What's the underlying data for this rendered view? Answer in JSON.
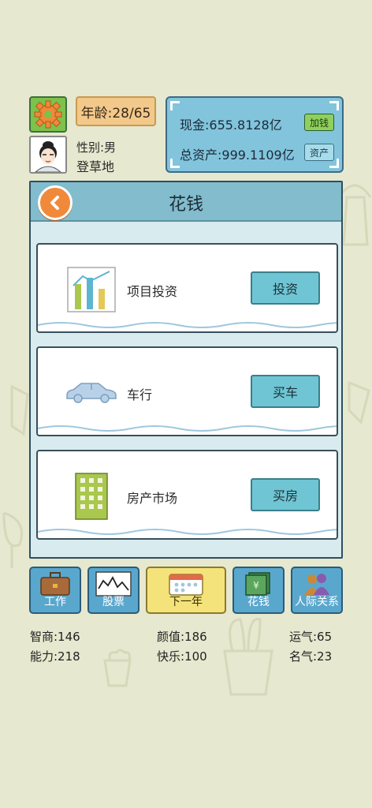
{
  "status": {
    "age_label": "年龄:28/65",
    "gender_label": "性别:男",
    "title": "登草地"
  },
  "money": {
    "cash_label": "现金:655.8128亿",
    "cash_button": "加钱",
    "assets_label": "总资产:999.1109亿",
    "assets_button": "资产"
  },
  "panel": {
    "title": "花钱",
    "cards": [
      {
        "label": "项目投资",
        "button": "投资",
        "icon": "chart-icon"
      },
      {
        "label": "车行",
        "button": "买车",
        "icon": "car-icon"
      },
      {
        "label": "房产市场",
        "button": "买房",
        "icon": "building-icon"
      }
    ]
  },
  "nav": {
    "items": [
      {
        "label": "工作",
        "icon": "briefcase-icon"
      },
      {
        "label": "股票",
        "icon": "stock-chart-icon"
      },
      {
        "label": "下一年",
        "icon": "calendar-icon"
      },
      {
        "label": "花钱",
        "icon": "money-icon"
      },
      {
        "label": "人际关系",
        "icon": "people-icon"
      }
    ]
  },
  "stats": {
    "iq": "智商:146",
    "ability": "能力:218",
    "looks": "颜值:186",
    "happiness": "快乐:100",
    "luck": "运气:65",
    "fame": "名气:23"
  },
  "colors": {
    "background": "#e6e8cf",
    "panel_header": "#82bccd",
    "action_button": "#6fc5d3",
    "nav_button": "#5aa7cd",
    "next_year": "#f4e37a",
    "back_button": "#f08a3a"
  }
}
